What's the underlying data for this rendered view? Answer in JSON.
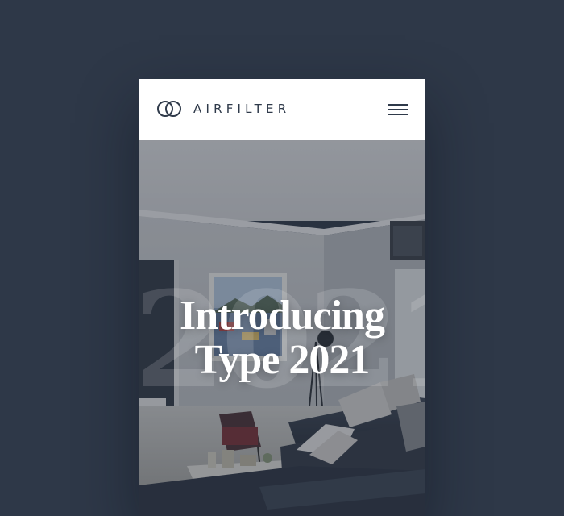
{
  "brand": {
    "name": "AIRFILTER",
    "logo_icon": "interlocked-rings-icon",
    "text_color": "#2f3a4a"
  },
  "header": {
    "menu_icon": "hamburger-menu-icon"
  },
  "hero": {
    "bg_year": "2021",
    "headline_line1": "Introducing",
    "headline_line2": "Type 2021",
    "image_subject": "living-room-photo"
  },
  "colors": {
    "page_background": "#2e3848",
    "header_background": "#ffffff",
    "headline": "#ffffff"
  }
}
